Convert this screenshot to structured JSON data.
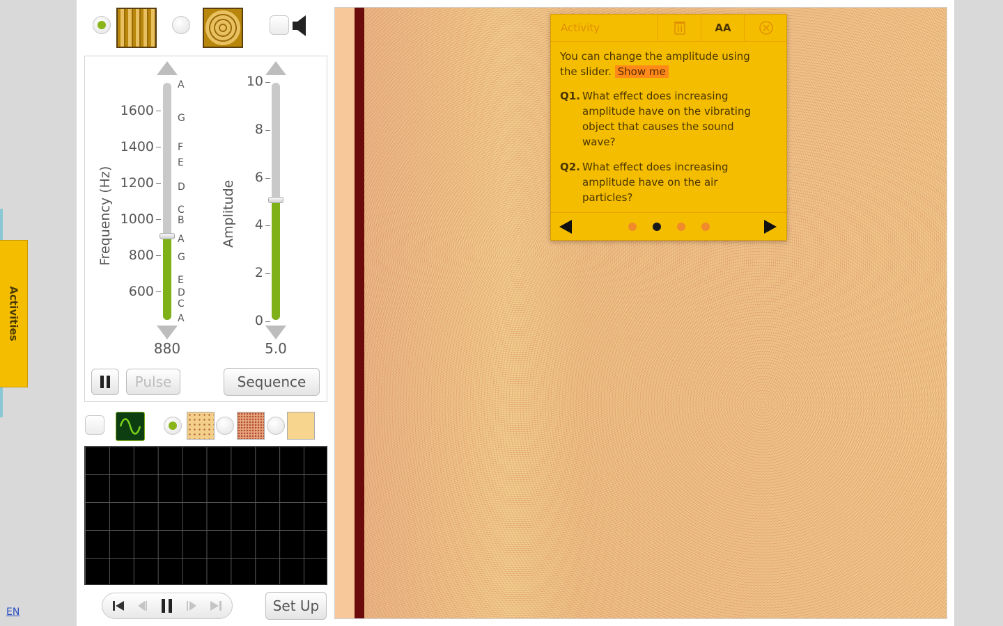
{
  "sidebar": {
    "activities_label": "Activities",
    "language": "EN"
  },
  "source": {
    "options": [
      "tuning-fork-bars",
      "vibrating-membrane"
    ],
    "selected": "tuning-fork-bars",
    "sound_enabled": false
  },
  "frequency": {
    "title": "Frequency (Hz)",
    "ticks": [
      "1600",
      "1400",
      "1200",
      "1000",
      "800",
      "600"
    ],
    "notes": [
      "A",
      "G",
      "F",
      "E",
      "D",
      "C",
      "B",
      "A",
      "G",
      "E",
      "D",
      "C",
      "A"
    ],
    "value": "880",
    "slider_fraction": 0.35
  },
  "amplitude": {
    "title": "Amplitude",
    "ticks": [
      "10",
      "8",
      "6",
      "4",
      "2",
      "0"
    ],
    "value": "5.0",
    "slider_fraction": 0.5
  },
  "controls": {
    "pulse_label": "Pulse",
    "sequence_label": "Sequence",
    "setup_label": "Set Up"
  },
  "view": {
    "show_wave_checked": false,
    "selected_particle_view": "sparse"
  },
  "activity": {
    "title": "Activity",
    "font_size_label": "AA",
    "intro": "You can change the amplitude using the slider.",
    "show_me": "Show me",
    "questions": [
      {
        "label": "Q1.",
        "text": "What effect does increasing amplitude have on the vibrating object that causes the sound wave?"
      },
      {
        "label": "Q2.",
        "text": "What effect does increasing amplitude have on the air particles?"
      }
    ],
    "page_count": 4,
    "current_page": 2
  },
  "colors": {
    "accent_green": "#7fb017",
    "activity_yellow": "#f5bd00",
    "show_me_orange": "#ff8a1a",
    "wall_red": "#6c0b0b"
  }
}
